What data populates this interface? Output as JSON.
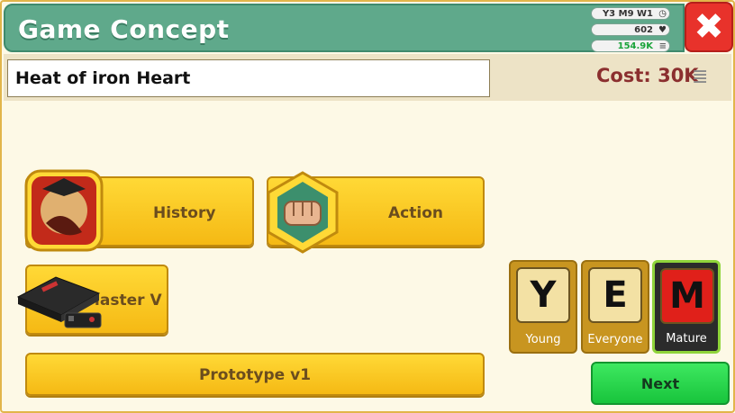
{
  "header": {
    "title": "Game Concept",
    "date": "Y3 M9 W1",
    "fans": "602",
    "money": "154.9K"
  },
  "concept": {
    "game_name": "Heat of iron Heart",
    "cost_label": "Cost: 30K"
  },
  "options": {
    "topic": "History",
    "genre": "Action",
    "platform": "Master V",
    "engine": "Prototype v1"
  },
  "ratings": [
    {
      "letter": "Y",
      "label": "Young",
      "selected": false
    },
    {
      "letter": "E",
      "label": "Everyone",
      "selected": false
    },
    {
      "letter": "M",
      "label": "Mature",
      "selected": true
    }
  ],
  "actions": {
    "next_label": "Next"
  },
  "colors": {
    "header_green": "#5fa98b",
    "button_yellow": "#ffd936",
    "next_green": "#2fd850",
    "cost_red": "#8b2f2f",
    "close_red": "#e8322b"
  }
}
